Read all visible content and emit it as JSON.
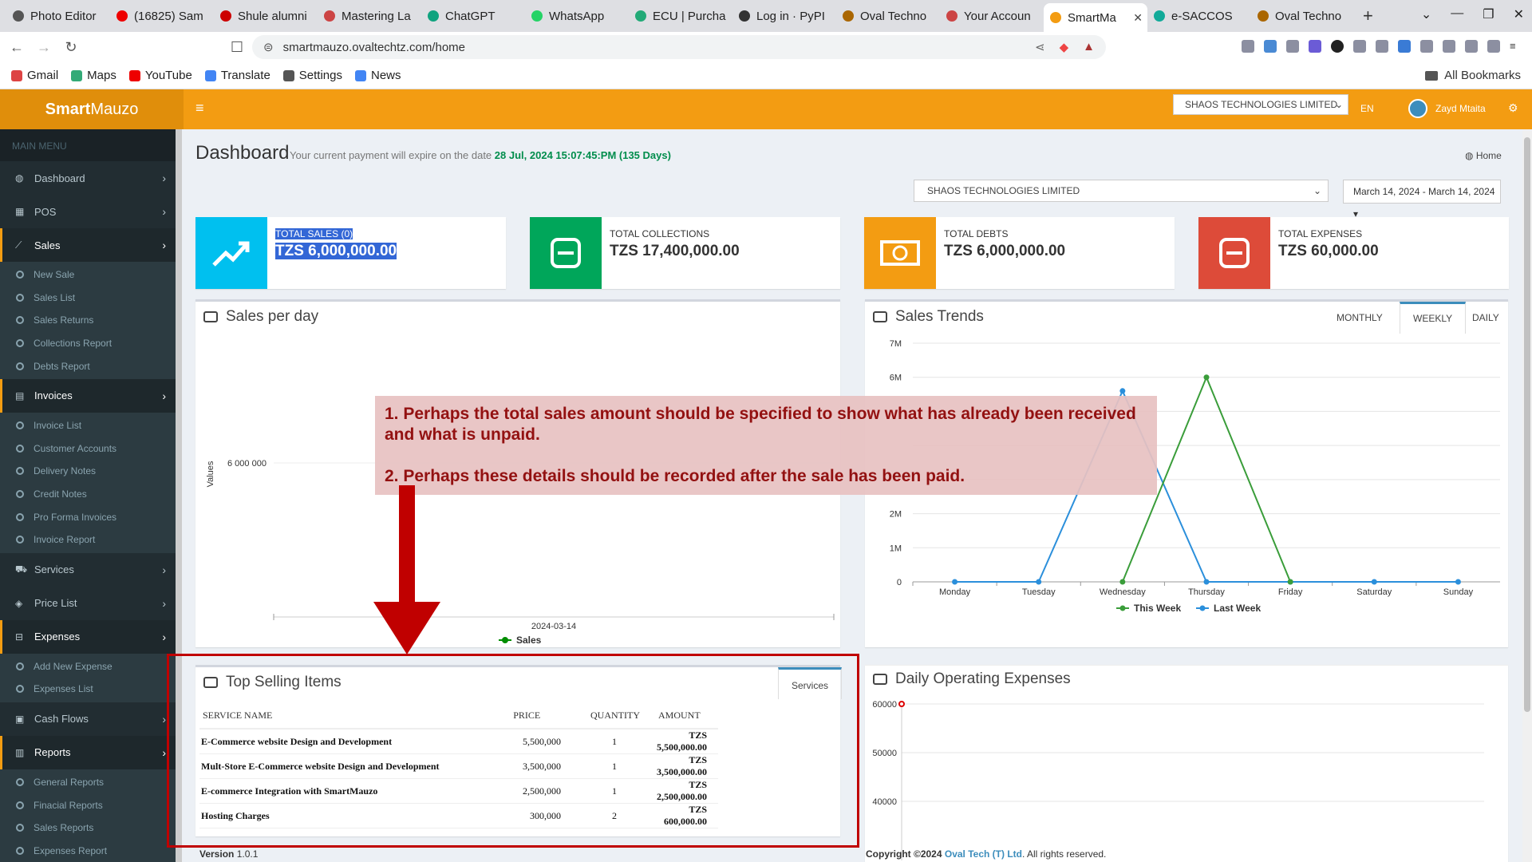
{
  "browser": {
    "tabs": [
      {
        "label": "Photo Editor",
        "color": "#555"
      },
      {
        "label": "(16825) Sam",
        "color": "#e00"
      },
      {
        "label": "Shule alumni",
        "color": "#c00"
      },
      {
        "label": "Mastering La",
        "color": "#c44"
      },
      {
        "label": "ChatGPT",
        "color": "#10a37f"
      },
      {
        "label": "WhatsApp",
        "color": "#25d366"
      },
      {
        "label": "ECU | Purcha",
        "color": "#2a7"
      },
      {
        "label": "Log in · PyPI",
        "color": "#333"
      },
      {
        "label": "Oval Techno",
        "color": "#a60"
      },
      {
        "label": "Your Accoun",
        "color": "#c44"
      },
      {
        "label": "SmartMa",
        "color": "#f39c12"
      },
      {
        "label": "e-SACCOS",
        "color": "#1a9"
      },
      {
        "label": "Oval Techno",
        "color": "#a60"
      }
    ],
    "active_tab": 10,
    "url": "smartmauzo.ovaltechtz.com/home",
    "bookmarks": [
      {
        "label": "Gmail",
        "color": "#d44"
      },
      {
        "label": "Maps",
        "color": "#3a7"
      },
      {
        "label": "YouTube",
        "color": "#e00"
      },
      {
        "label": "Translate",
        "color": "#4285f4"
      },
      {
        "label": "Settings",
        "color": "#555"
      },
      {
        "label": "News",
        "color": "#4285f4"
      }
    ],
    "all_bookmarks": "All Bookmarks"
  },
  "app": {
    "logo_bold": "Smart",
    "logo_rest": "Mauzo",
    "company": "SHAOS TECHNOLOGIES LIMITED",
    "lang": "EN",
    "user": "Zayd Mtaita"
  },
  "sidebar": {
    "header": "MAIN MENU",
    "dashboard": "Dashboard",
    "pos": "POS",
    "sales": "Sales",
    "sales_sub": [
      "New Sale",
      "Sales List",
      "Sales Returns",
      "Collections Report",
      "Debts Report"
    ],
    "invoices": "Invoices",
    "invoices_sub": [
      "Invoice List",
      "Customer Accounts",
      "Delivery Notes",
      "Credit Notes",
      "Pro Forma Invoices",
      "Invoice Report"
    ],
    "services": "Services",
    "price_list": "Price List",
    "expenses": "Expenses",
    "expenses_sub": [
      "Add New Expense",
      "Expenses List"
    ],
    "cash_flows": "Cash Flows",
    "reports": "Reports",
    "reports_sub": [
      "General Reports",
      "Finacial Reports",
      "Sales Reports",
      "Expenses Report"
    ]
  },
  "dashboard": {
    "title": "Dashboard",
    "expiry_text": "Your current payment will expire on the date",
    "expiry_date": "28 Jul, 2024 15:07:45:PM (135 Days)",
    "home": "Home",
    "filter_company": "SHAOS TECHNOLOGIES LIMITED",
    "date_range": "March 14, 2024 - March 14, 2024",
    "cards": [
      {
        "label": "TOTAL SALES (0)",
        "value": "TZS 6,000,000.00",
        "color": "#00c0ef"
      },
      {
        "label": "TOTAL COLLECTIONS",
        "value": "TZS 17,400,000.00",
        "color": "#00a65a"
      },
      {
        "label": "TOTAL DEBTS",
        "value": "TZS 6,000,000.00",
        "color": "#f39c12"
      },
      {
        "label": "TOTAL EXPENSES",
        "value": "TZS 60,000.00",
        "color": "#dd4b39"
      }
    ],
    "sales_per_day_title": "Sales per day",
    "sales_trends_title": "Sales Trends",
    "trend_tabs": [
      "MONTHLY",
      "WEEKLY",
      "DAILY"
    ],
    "top_items_title": "Top Selling Items",
    "top_items_tab": "Services",
    "top_items_headers": [
      "SERVICE NAME",
      "PRICE",
      "QUANTITY",
      "AMOUNT"
    ],
    "top_items": [
      {
        "name": "E-Commerce website Design and Development",
        "price": "5,500,000",
        "qty": "1",
        "amount": "TZS 5,500,000.00"
      },
      {
        "name": "Mult-Store E-Commerce website Design and Development",
        "price": "3,500,000",
        "qty": "1",
        "amount": "TZS 3,500,000.00"
      },
      {
        "name": "E-commerce Integration with SmartMauzo",
        "price": "2,500,000",
        "qty": "1",
        "amount": "TZS 2,500,000.00"
      },
      {
        "name": "Hosting Charges",
        "price": "300,000",
        "qty": "2",
        "amount": "TZS 600,000.00"
      }
    ],
    "daily_expenses_title": "Daily Operating Expenses"
  },
  "annotation": {
    "line1": "1. Perhaps the total sales amount should be specified to show what has already been received and what is unpaid.",
    "line2": "2. Perhaps these details should be recorded after the sale has been paid."
  },
  "footer": {
    "version_label": "Version",
    "version": "1.0.1",
    "copyright": "Copyright ©2024",
    "company_link": "Oval Tech (T) Ltd",
    "rights": ". All rights reserved."
  },
  "chart_data": [
    {
      "type": "line",
      "title": "Sales per day",
      "ylabel": "Values",
      "categories": [
        "2024-03-14"
      ],
      "y_tick_labels": [
        "6 000 000"
      ],
      "series": [
        {
          "name": "Sales",
          "values": [
            6000000
          ],
          "color": "#008d00"
        }
      ]
    },
    {
      "type": "line",
      "title": "Sales Trends",
      "categories": [
        "Monday",
        "Tuesday",
        "Wednesday",
        "Thursday",
        "Friday",
        "Saturday",
        "Sunday"
      ],
      "y_ticks": [
        0,
        1000000,
        2000000,
        3000000,
        4000000,
        5000000,
        6000000,
        7000000
      ],
      "y_tick_labels": [
        "0",
        "1M",
        "2M",
        "",
        "",
        "",
        "6M",
        "7M"
      ],
      "ylim": [
        0,
        7000000
      ],
      "series": [
        {
          "name": "This Week",
          "values": [
            null,
            null,
            0,
            6000000,
            0,
            null,
            null
          ],
          "color": "#3a9d3a"
        },
        {
          "name": "Last Week",
          "values": [
            0,
            0,
            5600000,
            0,
            0,
            0,
            0
          ],
          "color": "#2b8fdb"
        }
      ]
    },
    {
      "type": "line",
      "title": "Daily Operating Expenses",
      "y_ticks": [
        40000,
        50000,
        60000
      ],
      "y_tick_labels": [
        "40000",
        "50000",
        "60000"
      ],
      "series": [
        {
          "name": "",
          "values": [
            60000
          ],
          "color": "#dd0000"
        }
      ]
    }
  ]
}
